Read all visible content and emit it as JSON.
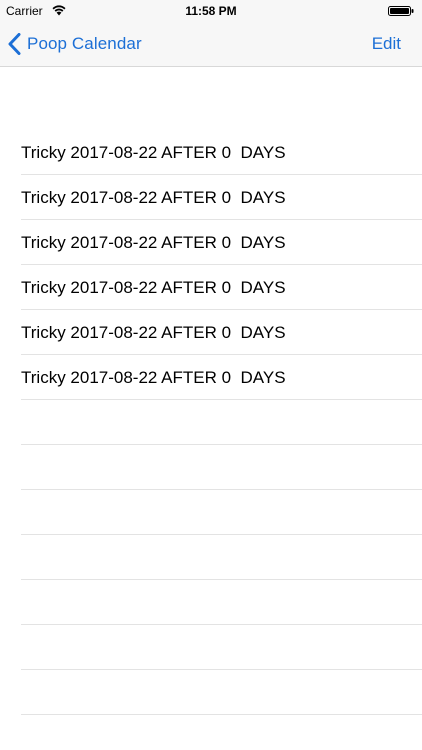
{
  "status_bar": {
    "carrier": "Carrier",
    "wifi_icon": "wifi-icon",
    "time": "11:58 PM",
    "battery_icon": "battery-icon"
  },
  "nav": {
    "back_icon": "chevron-left-icon",
    "back_label": "Poop Calendar",
    "edit_label": "Edit",
    "accent_color": "#1c6fd6"
  },
  "table": {
    "rows": [
      {
        "label": "Tricky 2017-08-22 AFTER 0  DAYS"
      },
      {
        "label": "Tricky 2017-08-22 AFTER 0  DAYS"
      },
      {
        "label": "Tricky 2017-08-22 AFTER 0  DAYS"
      },
      {
        "label": "Tricky 2017-08-22 AFTER 0  DAYS"
      },
      {
        "label": "Tricky 2017-08-22 AFTER 0  DAYS"
      },
      {
        "label": "Tricky 2017-08-22 AFTER 0  DAYS"
      },
      {
        "label": ""
      },
      {
        "label": ""
      },
      {
        "label": ""
      },
      {
        "label": ""
      },
      {
        "label": ""
      },
      {
        "label": ""
      },
      {
        "label": ""
      }
    ]
  }
}
